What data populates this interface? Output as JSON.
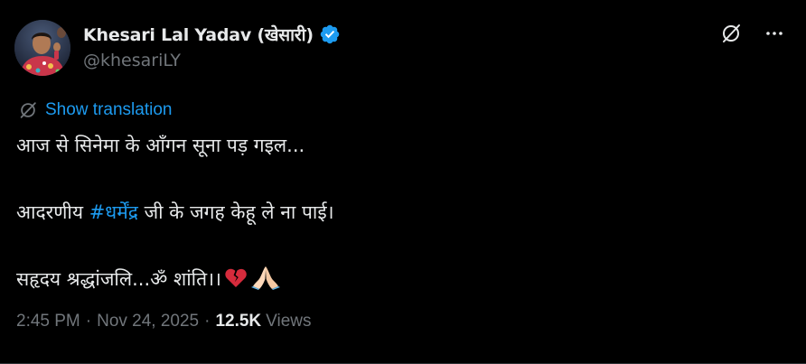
{
  "author": {
    "display_name": "Khesari Lal Yadav (खेसारी)",
    "handle": "@khesariLY",
    "verified": true,
    "avatar_icon": "profile-photo"
  },
  "actions": {
    "grok_icon": "slash-circle-icon",
    "more_icon": "more-horizontal-icon"
  },
  "translation": {
    "label": "Show translation",
    "icon": "translate-slash-icon"
  },
  "tweet": {
    "line1": "आज से सिनेमा के आँगन सूना पड़ गइल...",
    "line2_prefix": "आदरणीय ",
    "hashtag": "#धर्मेंद्र",
    "line2_suffix": " जी के जगह केहू ले ना पाई।",
    "line3": "सहृदय श्रद्धांजलि...ॐ शांति।।",
    "emojis": [
      "broken-heart-icon",
      "folded-hands-icon"
    ]
  },
  "meta": {
    "time": "2:45 PM",
    "date": "Nov 24, 2025",
    "views_count": "12.5K",
    "views_label": "Views"
  },
  "colors": {
    "background": "#000000",
    "text_primary": "#e7e9ea",
    "text_secondary": "#71767b",
    "accent": "#1d9bf0",
    "divider": "#2f3336"
  }
}
